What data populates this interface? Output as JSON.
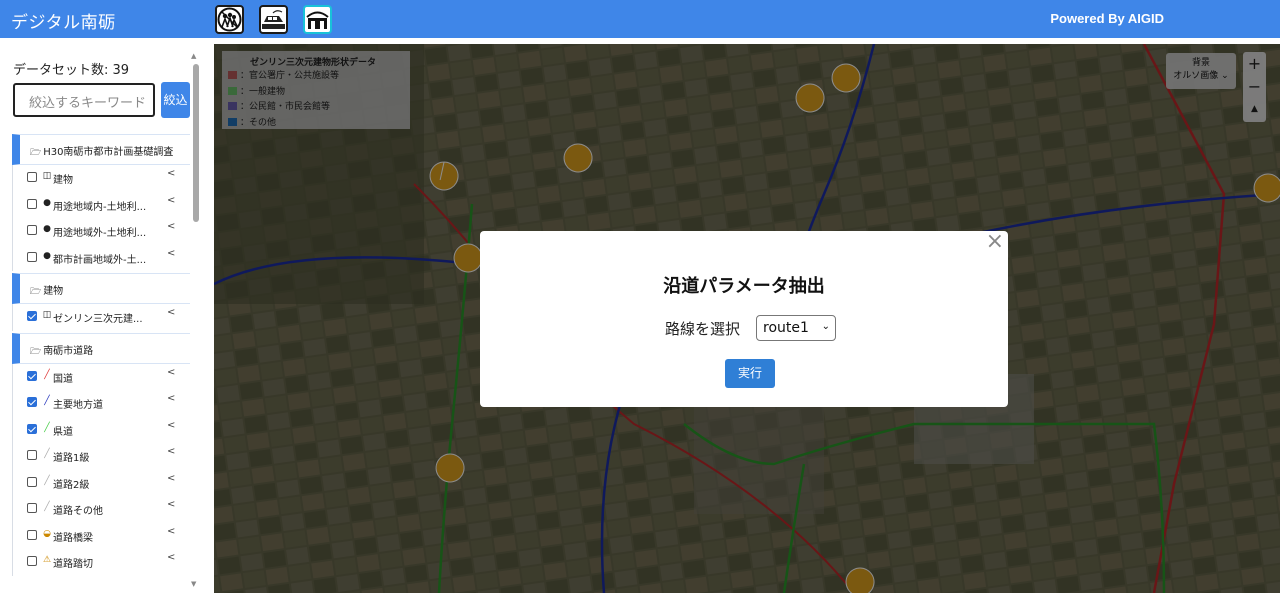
{
  "header": {
    "app_title": "デジタル南砺",
    "powered_by": "Powered By AIGID",
    "icons": [
      "people-group-icon",
      "vehicle-icon",
      "building-gate-icon"
    ]
  },
  "sidebar": {
    "dataset_count": "データセット数: 39",
    "search_placeholder": "絞込するキーワード",
    "search_button": "絞込",
    "groups": [
      {
        "label": "H30南砺市都市計画基礎調査",
        "items": [
          {
            "label": "建物",
            "icon": "building-outline-icon",
            "checked": false
          },
          {
            "label": "用途地域内-土地利...",
            "icon": "dot-icon",
            "checked": false
          },
          {
            "label": "用途地域外-土地利...",
            "icon": "dot-icon",
            "checked": false
          },
          {
            "label": "都市計画地域外-土...",
            "icon": "dot-icon",
            "checked": false
          }
        ]
      },
      {
        "label": "建物",
        "items": [
          {
            "label": "ゼンリン三次元建...",
            "icon": "building-outline-icon",
            "checked": true
          }
        ]
      },
      {
        "label": "南砺市道路",
        "items": [
          {
            "label": "国道",
            "icon": "line-red-icon",
            "checked": true
          },
          {
            "label": "主要地方道",
            "icon": "line-blue-icon",
            "checked": true
          },
          {
            "label": "県道",
            "icon": "line-green-icon",
            "checked": true
          },
          {
            "label": "道路1級",
            "icon": "line-gray-icon",
            "checked": false
          },
          {
            "label": "道路2級",
            "icon": "line-gray-icon",
            "checked": false
          },
          {
            "label": "道路その他",
            "icon": "line-gray-icon",
            "checked": false
          },
          {
            "label": "道路橋梁",
            "icon": "bridge-icon",
            "checked": false
          },
          {
            "label": "道路踏切",
            "icon": "crossing-icon",
            "checked": false
          }
        ]
      }
    ]
  },
  "map": {
    "legend": {
      "title": "ゼンリン三次元建物形状データ",
      "entries": [
        {
          "label": "：官公署庁・公共施設等",
          "color": "#b85a5a"
        },
        {
          "label": "：一般建物",
          "color": "#6ac06a"
        },
        {
          "label": "：公民館・市民会館等",
          "color": "#6a5fb0"
        },
        {
          "label": "：その他",
          "color": "#1f6fb8"
        }
      ]
    },
    "background_control": {
      "title": "背景",
      "value": "オルソ画像"
    },
    "zoom_in": "+",
    "zoom_out": "−",
    "reset_north": "▲"
  },
  "modal": {
    "title": "沿道パラメータ抽出",
    "select_label": "路線を選択",
    "select_value": "route1",
    "run_button": "実行",
    "close": "×"
  }
}
